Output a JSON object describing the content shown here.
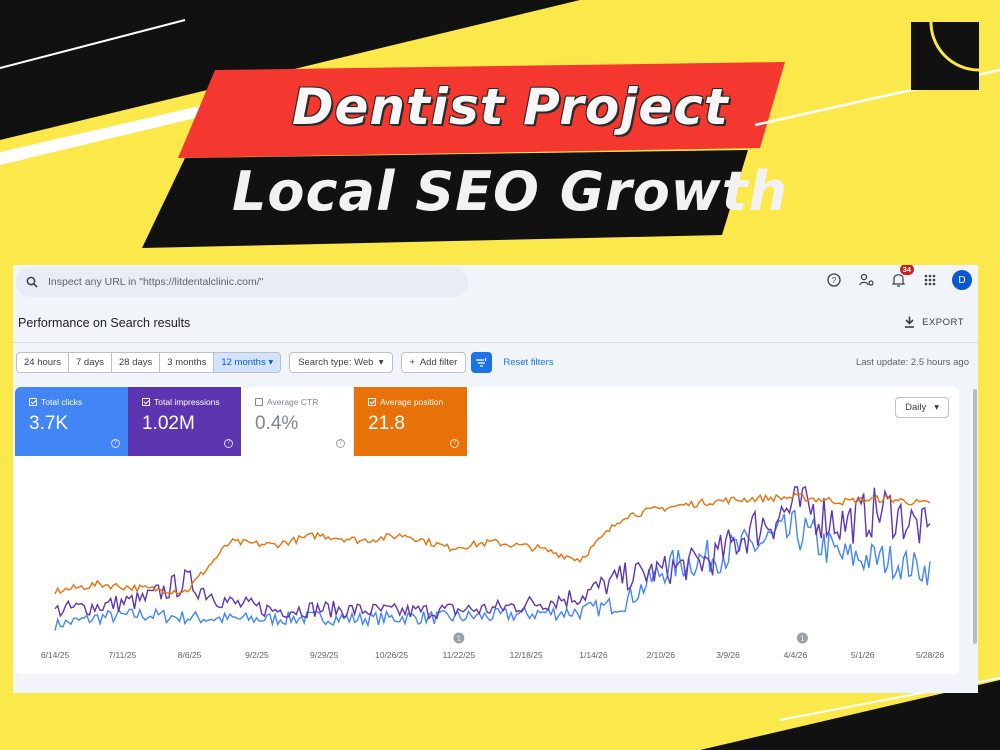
{
  "banner": {
    "line1": "Dentist Project",
    "line2": "Local SEO Growth"
  },
  "search": {
    "placeholder": "Inspect any URL in \"https://litdentalclinic.com/\"",
    "icon": "search-icon"
  },
  "toolbar": {
    "help_icon": "help-icon",
    "manage_users_icon": "manage-users-icon",
    "notifications_icon": "bell-icon",
    "notifications_count": "34",
    "apps_icon": "apps-grid-icon",
    "avatar_letter": "D"
  },
  "page": {
    "title": "Performance on Search results",
    "export_label": "EXPORT",
    "last_update": "Last update: 2.5 hours ago"
  },
  "filters": {
    "date_ranges": [
      "24 hours",
      "7 days",
      "28 days",
      "3 months",
      "12 months ▾"
    ],
    "active_range": "12 months ▾",
    "search_type": "Search type: Web",
    "add_filter": "Add filter",
    "reset": "Reset filters",
    "granularity": "Daily"
  },
  "metrics": [
    {
      "label": "Total clicks",
      "value": "3.7K",
      "checked": true,
      "color": "#4285f4"
    },
    {
      "label": "Total impressions",
      "value": "1.02M",
      "checked": true,
      "color": "#5e35b1"
    },
    {
      "label": "Average CTR",
      "value": "0.4%",
      "checked": false,
      "color": "#ffffff"
    },
    {
      "label": "Average position",
      "value": "21.8",
      "checked": true,
      "color": "#e8710a"
    }
  ],
  "chart_data": {
    "type": "line",
    "x": [
      "6/14/25",
      "7/11/25",
      "8/6/25",
      "9/2/25",
      "9/29/25",
      "10/26/25",
      "11/22/25",
      "12/18/25",
      "1/14/26",
      "2/10/26",
      "3/9/26",
      "4/4/26",
      "5/1/26",
      "5/28/26"
    ],
    "annotations": [
      {
        "x": "11/22/25",
        "label": "1"
      },
      {
        "x": "4/4/26",
        "label": "1"
      }
    ],
    "series": [
      {
        "name": "Total clicks",
        "color": "#4285f4",
        "values": [
          0.05,
          0.1,
          0.12,
          0.1,
          0.09,
          0.09,
          0.1,
          0.09,
          0.1,
          0.1,
          0.11,
          0.13,
          0.14,
          0.2,
          0.45,
          0.52,
          0.6,
          0.7,
          0.52,
          0.5,
          0.42
        ]
      },
      {
        "name": "Total impressions",
        "color": "#5e35b1",
        "values": [
          0.15,
          0.18,
          0.22,
          0.35,
          0.2,
          0.15,
          0.16,
          0.15,
          0.14,
          0.15,
          0.16,
          0.2,
          0.25,
          0.38,
          0.43,
          0.5,
          0.72,
          0.88,
          0.75,
          0.85,
          0.68
        ]
      },
      {
        "name": "Average position",
        "color": "#e8710a",
        "values": [
          0.28,
          0.33,
          0.3,
          0.28,
          0.62,
          0.6,
          0.67,
          0.63,
          0.67,
          0.58,
          0.62,
          0.58,
          0.5,
          0.8,
          0.86,
          0.9,
          0.92,
          0.93,
          0.9,
          0.92,
          0.88
        ]
      }
    ],
    "grid": false,
    "legend": "none"
  }
}
